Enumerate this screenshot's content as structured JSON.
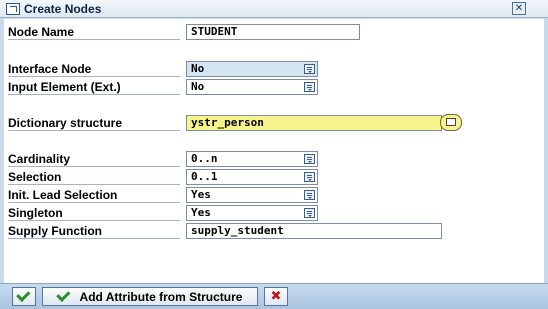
{
  "window": {
    "title": "Create Nodes",
    "close_icon": "close-icon"
  },
  "form": {
    "node_name": {
      "label": "Node Name",
      "value": "STUDENT"
    },
    "interface_node": {
      "label": "Interface Node",
      "value": "No"
    },
    "input_element": {
      "label": "Input Element (Ext.)",
      "value": "No"
    },
    "dictionary_structure": {
      "label": "Dictionary structure",
      "value": "ystr_person"
    },
    "cardinality": {
      "label": "Cardinality",
      "value": "0..n"
    },
    "selection": {
      "label": "Selection",
      "value": "0..1"
    },
    "init_lead_selection": {
      "label": "Init. Lead Selection",
      "value": "Yes"
    },
    "singleton": {
      "label": "Singleton",
      "value": "Yes"
    },
    "supply_function": {
      "label": "Supply Function",
      "value": "supply_student"
    }
  },
  "toolbar": {
    "add_attr_label": "Add Attribute from Structure"
  },
  "colors": {
    "required_field": "#f7f48c",
    "readonly_field": "#d4e4f3",
    "background": "#c9d9ea",
    "confirm": "#2f8a2a",
    "cancel": "#c01818"
  }
}
